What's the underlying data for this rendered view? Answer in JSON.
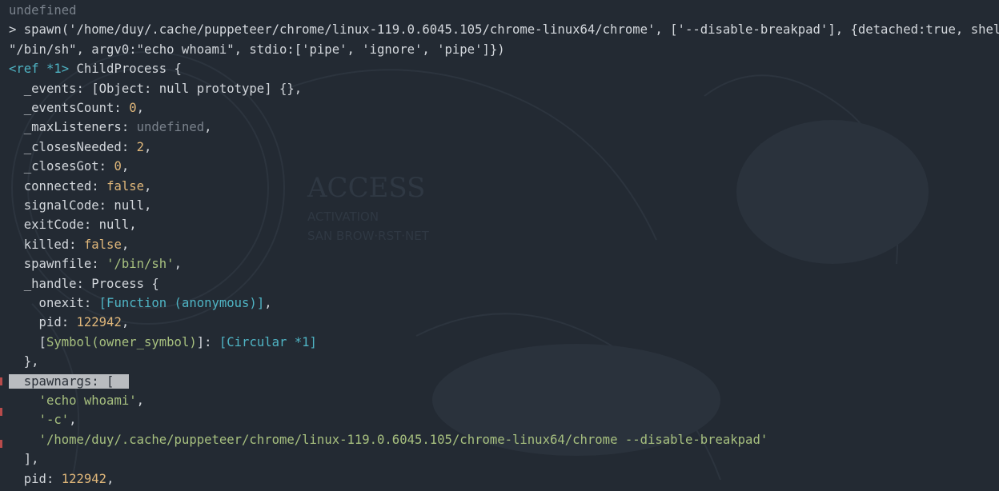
{
  "terminal": {
    "lines": [
      {
        "segments": [
          {
            "t": "undefined",
            "c": "dim"
          }
        ]
      },
      {
        "segments": [
          {
            "t": "> spawn('/home/duy/.cache/puppeteer/chrome/linux-119.0.6045.105/chrome-linux64/chrome', ['--disable-breakpad'], {detached:true, shell:",
            "c": ""
          }
        ]
      },
      {
        "segments": [
          {
            "t": "\"/bin/sh\", argv0:\"echo whoami\", stdio:['pipe', 'ignore', 'pipe']})",
            "c": ""
          }
        ]
      },
      {
        "segments": [
          {
            "t": "<ref *1>",
            "c": "cyan"
          },
          {
            "t": " ChildProcess {",
            "c": ""
          }
        ]
      },
      {
        "segments": [
          {
            "t": "  _events: [Object: null prototype] {},",
            "c": ""
          }
        ]
      },
      {
        "segments": [
          {
            "t": "  _eventsCount: ",
            "c": ""
          },
          {
            "t": "0",
            "c": "num"
          },
          {
            "t": ",",
            "c": ""
          }
        ]
      },
      {
        "segments": [
          {
            "t": "  _maxListeners: ",
            "c": ""
          },
          {
            "t": "undefined",
            "c": "undef"
          },
          {
            "t": ",",
            "c": ""
          }
        ]
      },
      {
        "segments": [
          {
            "t": "  _closesNeeded: ",
            "c": ""
          },
          {
            "t": "2",
            "c": "num"
          },
          {
            "t": ",",
            "c": ""
          }
        ]
      },
      {
        "segments": [
          {
            "t": "  _closesGot: ",
            "c": ""
          },
          {
            "t": "0",
            "c": "num"
          },
          {
            "t": ",",
            "c": ""
          }
        ]
      },
      {
        "segments": [
          {
            "t": "  connected: ",
            "c": ""
          },
          {
            "t": "false",
            "c": "bool"
          },
          {
            "t": ",",
            "c": ""
          }
        ]
      },
      {
        "segments": [
          {
            "t": "  signalCode: null,",
            "c": ""
          }
        ]
      },
      {
        "segments": [
          {
            "t": "  exitCode: null,",
            "c": ""
          }
        ]
      },
      {
        "segments": [
          {
            "t": "  killed: ",
            "c": ""
          },
          {
            "t": "false",
            "c": "bool"
          },
          {
            "t": ",",
            "c": ""
          }
        ]
      },
      {
        "segments": [
          {
            "t": "  spawnfile: ",
            "c": ""
          },
          {
            "t": "'/bin/sh'",
            "c": "str"
          },
          {
            "t": ",",
            "c": ""
          }
        ]
      },
      {
        "segments": [
          {
            "t": "  _handle: Process {",
            "c": ""
          }
        ]
      },
      {
        "segments": [
          {
            "t": "    onexit: ",
            "c": ""
          },
          {
            "t": "[Function (anonymous)]",
            "c": "cyan"
          },
          {
            "t": ",",
            "c": ""
          }
        ]
      },
      {
        "segments": [
          {
            "t": "    pid: ",
            "c": ""
          },
          {
            "t": "122942",
            "c": "num"
          },
          {
            "t": ",",
            "c": ""
          }
        ]
      },
      {
        "segments": [
          {
            "t": "    [",
            "c": ""
          },
          {
            "t": "Symbol(owner_symbol)",
            "c": "green"
          },
          {
            "t": "]: ",
            "c": ""
          },
          {
            "t": "[Circular *1]",
            "c": "cyan"
          }
        ]
      },
      {
        "segments": [
          {
            "t": "  },",
            "c": ""
          }
        ]
      },
      {
        "segments": [
          {
            "t": "  spawnargs: [  ",
            "c": "sel"
          }
        ]
      },
      {
        "segments": [
          {
            "t": "    ",
            "c": ""
          },
          {
            "t": "'echo whoami'",
            "c": "str"
          },
          {
            "t": ",",
            "c": ""
          }
        ]
      },
      {
        "segments": [
          {
            "t": "    ",
            "c": ""
          },
          {
            "t": "'-c'",
            "c": "str"
          },
          {
            "t": ",",
            "c": ""
          }
        ]
      },
      {
        "segments": [
          {
            "t": "    ",
            "c": ""
          },
          {
            "t": "'/home/duy/.cache/puppeteer/chrome/linux-119.0.6045.105/chrome-linux64/chrome --disable-breakpad'",
            "c": "str"
          }
        ]
      },
      {
        "segments": [
          {
            "t": "  ],",
            "c": ""
          }
        ]
      },
      {
        "segments": [
          {
            "t": "  pid: ",
            "c": ""
          },
          {
            "t": "122942",
            "c": "num"
          },
          {
            "t": ",",
            "c": ""
          }
        ]
      }
    ]
  },
  "background": {
    "art_text_1": "ACCESS",
    "art_text_2": "ACTIVATION",
    "art_text_3": "SAN  BROW·RST·NET"
  },
  "colors": {
    "background": "#232a33",
    "foreground": "#d3d7dc",
    "number": "#e0b77a",
    "string": "#a7c07f",
    "cyan": "#4fb4c4",
    "dim": "#7a828c",
    "selection": "#b9bcc0"
  }
}
